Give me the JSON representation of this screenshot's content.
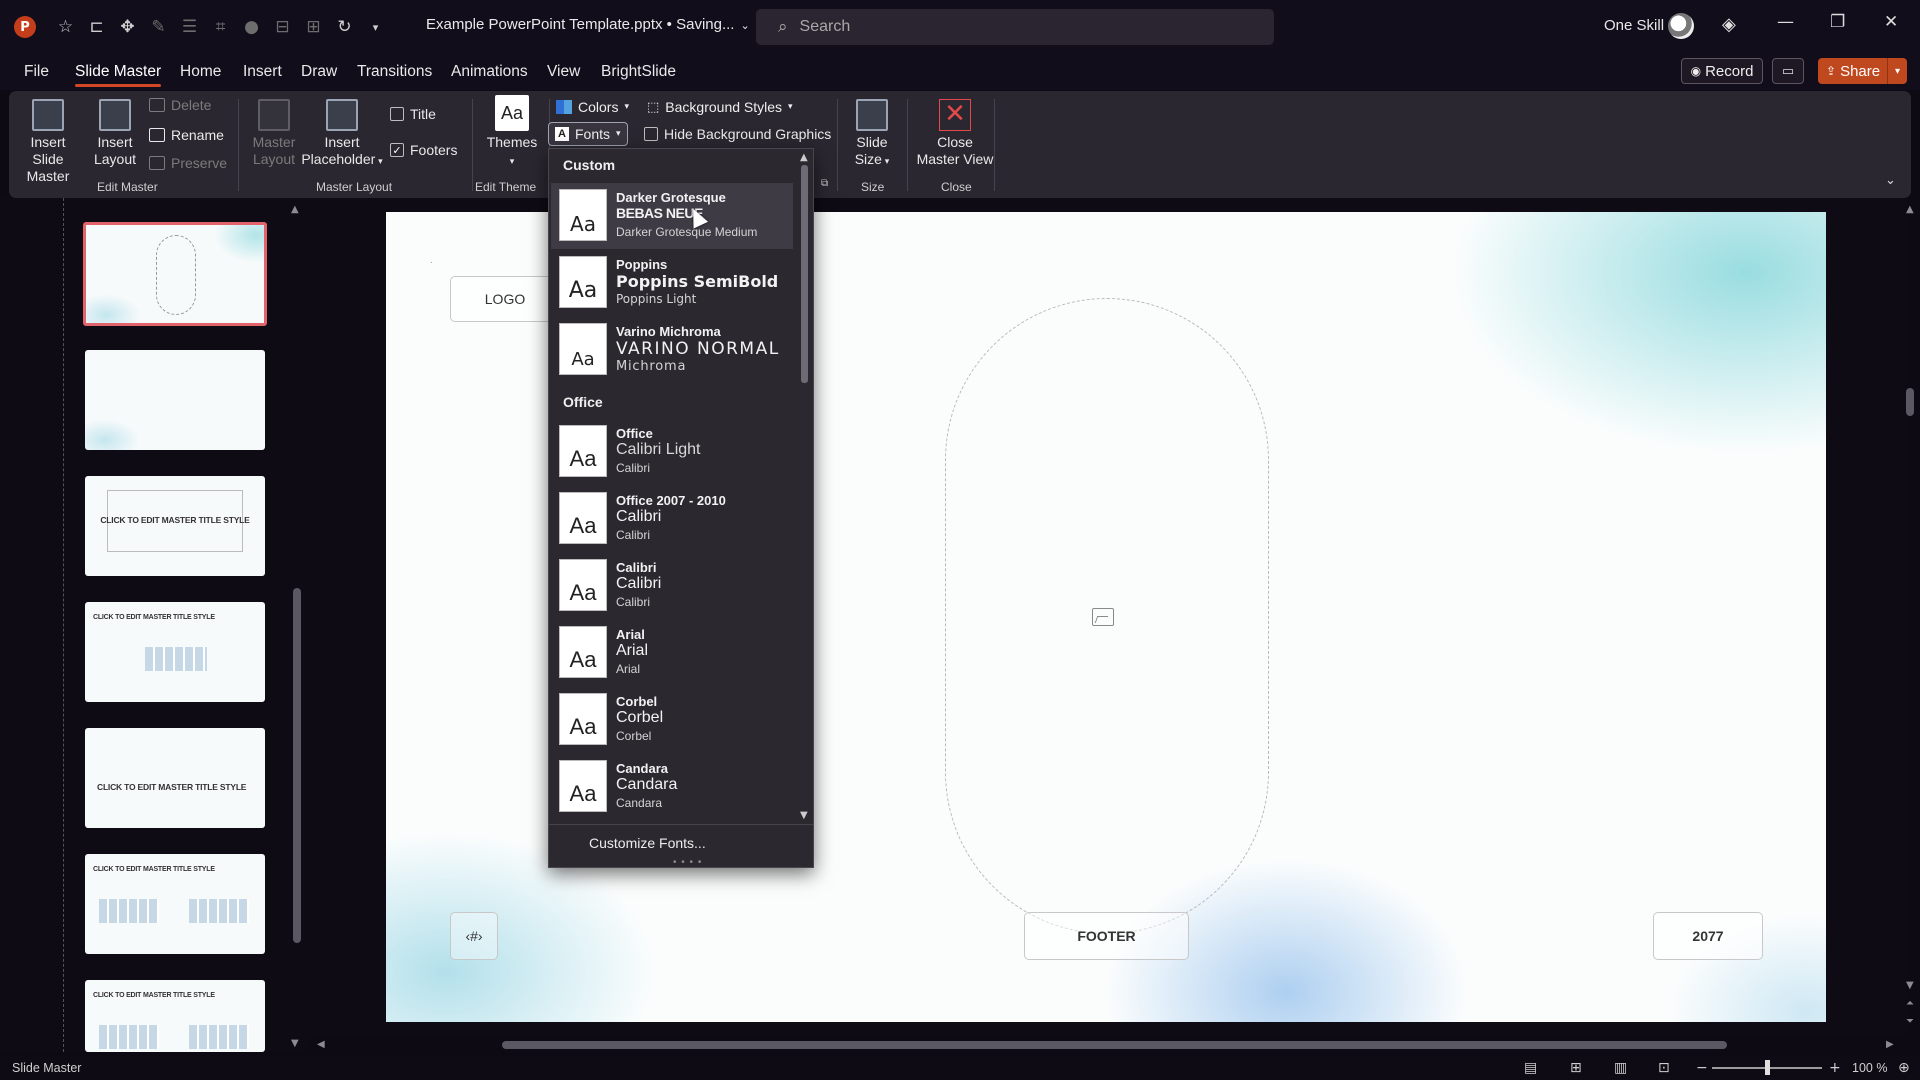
{
  "titlebar": {
    "doc_title": "Example PowerPoint Template.pptx • Saving...",
    "search_placeholder": "Search",
    "user_name": "One Skill"
  },
  "menu": {
    "tabs": [
      "File",
      "Slide Master",
      "Home",
      "Insert",
      "Draw",
      "Transitions",
      "Animations",
      "View",
      "BrightSlide"
    ],
    "active_tab": "Slide Master",
    "record_label": "Record",
    "share_label": "Share"
  },
  "ribbon": {
    "edit_master": {
      "insert_slide_master": "Insert Slide Master",
      "insert_layout": "Insert Layout",
      "delete": "Delete",
      "rename": "Rename",
      "preserve": "Preserve",
      "group_label": "Edit Master"
    },
    "master_layout": {
      "master_layout": "Master Layout",
      "insert_placeholder": "Insert Placeholder",
      "title_label": "Title",
      "footers_label": "Footers",
      "title_checked": false,
      "footers_checked": true,
      "group_label": "Master Layout"
    },
    "edit_theme": {
      "themes": "Themes",
      "group_label": "Edit Theme"
    },
    "background": {
      "colors": "Colors",
      "fonts": "Fonts",
      "background_styles": "Background Styles",
      "hide_background_graphics": "Hide Background Graphics",
      "hide_bg_checked": false
    },
    "size": {
      "slide_size": "Slide Size",
      "group_label": "Size"
    },
    "close": {
      "close_master_view": "Close Master View",
      "group_label": "Close"
    }
  },
  "fonts_menu": {
    "custom_header": "Custom",
    "office_header": "Office",
    "custom": [
      {
        "name": "Darker Grotesque",
        "heading": "BEBAS NEUE",
        "body": "Darker Grotesque Medium"
      },
      {
        "name": "Poppins",
        "heading": "Poppins SemiBold",
        "body": "Poppins Light"
      },
      {
        "name": "Varino Michroma",
        "heading": "VARINO NORMAL",
        "body": "Michroma"
      }
    ],
    "office": [
      {
        "name": "Office",
        "heading": "Calibri Light",
        "body": "Calibri"
      },
      {
        "name": "Office 2007 - 2010",
        "heading": "Calibri",
        "body": "Calibri"
      },
      {
        "name": "Calibri",
        "heading": "Calibri",
        "body": "Calibri"
      },
      {
        "name": "Arial",
        "heading": "Arial",
        "body": "Arial"
      },
      {
        "name": "Corbel",
        "heading": "Corbel",
        "body": "Corbel"
      },
      {
        "name": "Candara",
        "heading": "Candara",
        "body": "Candara"
      }
    ],
    "swatch_glyph": "Aa",
    "customize": "Customize Fonts..."
  },
  "thumbnails": {
    "title_text": "CLICK TO EDIT MASTER TITLE STYLE"
  },
  "slide": {
    "logo": "LOGO",
    "footer": "FOOTER",
    "year": "2077",
    "slide_number": "‹#›"
  },
  "statusbar": {
    "mode": "Slide Master",
    "zoom": "100 %"
  },
  "colors": {
    "accent": "#d24726",
    "share": "#c0481f",
    "selection": "#e1636c"
  }
}
